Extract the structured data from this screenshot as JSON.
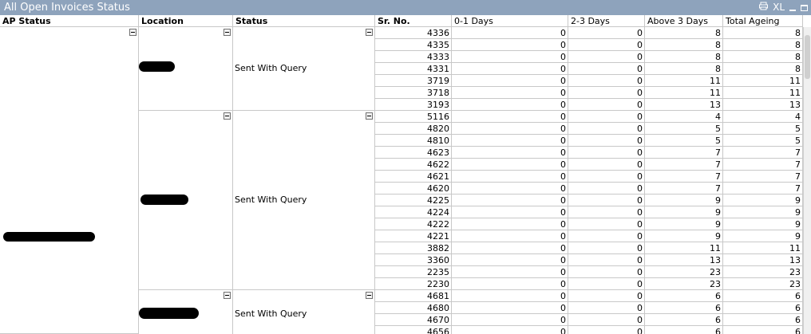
{
  "window": {
    "title": "All Open Invoices Status",
    "icons": [
      "print-icon",
      "xl-export",
      "restore-icon",
      "minimize-icon"
    ],
    "xl_label": "XL"
  },
  "colors": {
    "titlebar": "#8ea3bc",
    "grid_line": "#c8c8c8"
  },
  "headers": {
    "ap_status": "AP Status",
    "location": "Location",
    "status": "Status",
    "sr_no": "Sr. No.",
    "d01": "0-1 Days",
    "d23": "2-3 Days",
    "d3p": "Above 3 Days",
    "total": "Total Ageing"
  },
  "groups": [
    {
      "status": "Sent With Query",
      "rows": [
        [
          "4336",
          "0",
          "0",
          "8",
          "8"
        ],
        [
          "4335",
          "0",
          "0",
          "8",
          "8"
        ],
        [
          "4333",
          "0",
          "0",
          "8",
          "8"
        ],
        [
          "4331",
          "0",
          "0",
          "8",
          "8"
        ],
        [
          "3719",
          "0",
          "0",
          "11",
          "11"
        ],
        [
          "3718",
          "0",
          "0",
          "11",
          "11"
        ],
        [
          "3193",
          "0",
          "0",
          "13",
          "13"
        ]
      ]
    },
    {
      "status": "Sent With Query",
      "rows": [
        [
          "5116",
          "0",
          "0",
          "4",
          "4"
        ],
        [
          "4820",
          "0",
          "0",
          "5",
          "5"
        ],
        [
          "4810",
          "0",
          "0",
          "5",
          "5"
        ],
        [
          "4623",
          "0",
          "0",
          "7",
          "7"
        ],
        [
          "4622",
          "0",
          "0",
          "7",
          "7"
        ],
        [
          "4621",
          "0",
          "0",
          "7",
          "7"
        ],
        [
          "4620",
          "0",
          "0",
          "7",
          "7"
        ],
        [
          "4225",
          "0",
          "0",
          "9",
          "9"
        ],
        [
          "4224",
          "0",
          "0",
          "9",
          "9"
        ],
        [
          "4222",
          "0",
          "0",
          "9",
          "9"
        ],
        [
          "4221",
          "0",
          "0",
          "9",
          "9"
        ],
        [
          "3882",
          "0",
          "0",
          "11",
          "11"
        ],
        [
          "3360",
          "0",
          "0",
          "13",
          "13"
        ],
        [
          "2235",
          "0",
          "0",
          "23",
          "23"
        ],
        [
          "2230",
          "0",
          "0",
          "23",
          "23"
        ]
      ]
    },
    {
      "status": "Sent With Query",
      "rows": [
        [
          "4681",
          "0",
          "0",
          "6",
          "6"
        ],
        [
          "4680",
          "0",
          "0",
          "6",
          "6"
        ],
        [
          "4670",
          "0",
          "0",
          "6",
          "6"
        ],
        [
          "4656",
          "0",
          "0",
          "6",
          "6"
        ]
      ]
    }
  ]
}
